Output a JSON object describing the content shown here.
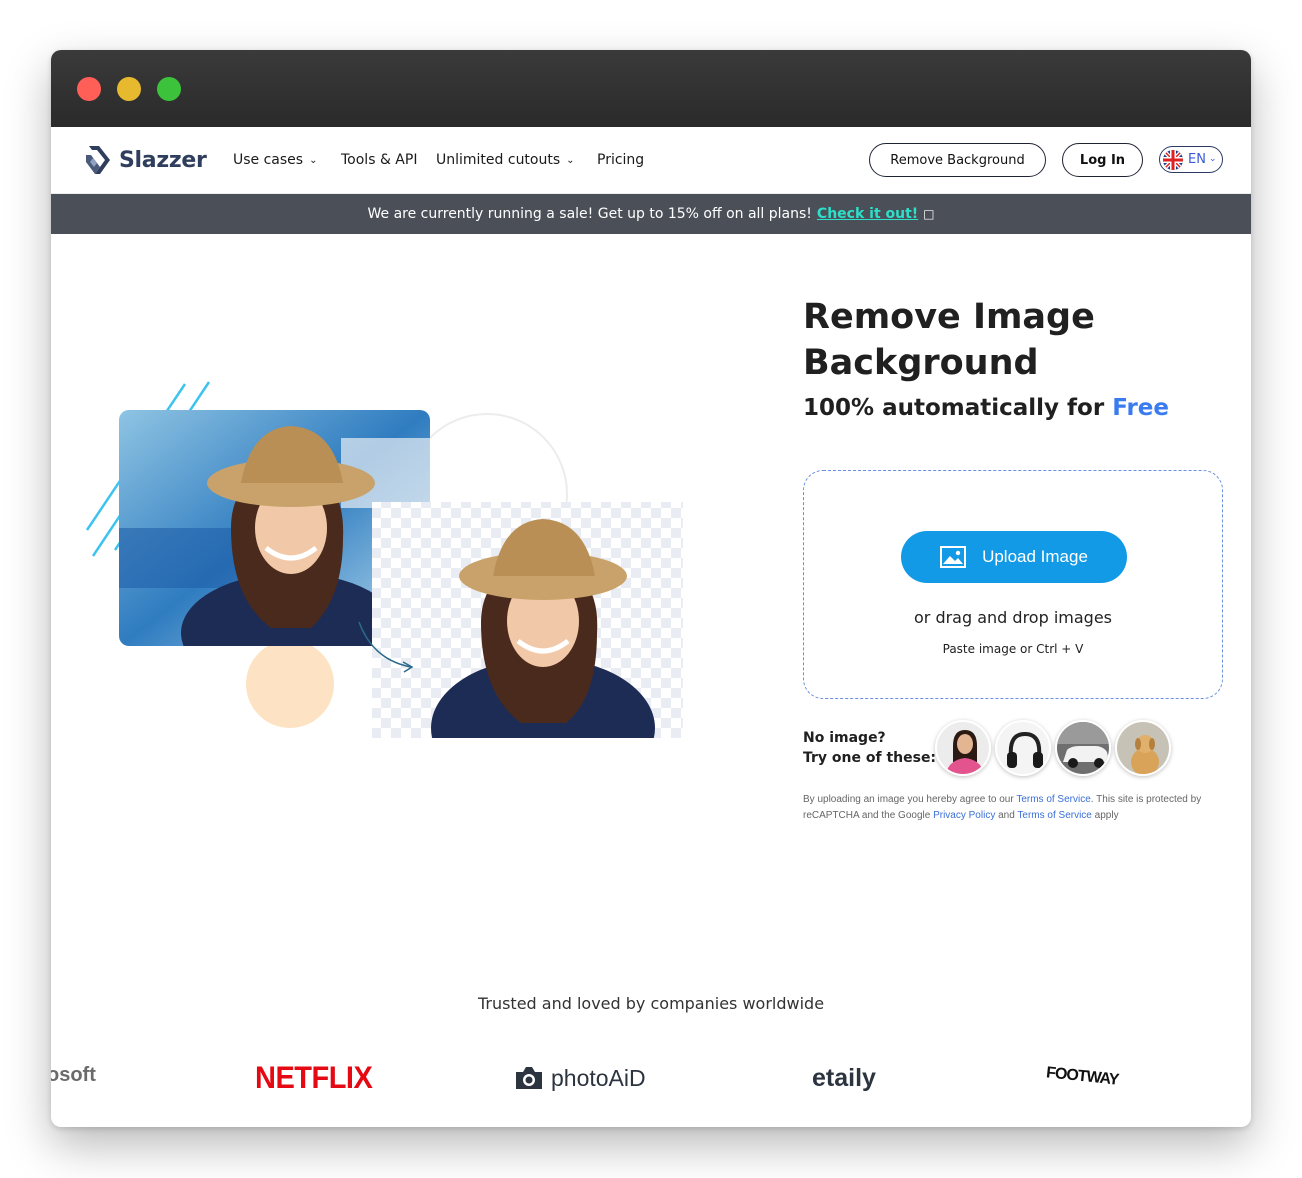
{
  "window": {
    "controls": [
      "close",
      "minimize",
      "zoom"
    ]
  },
  "nav": {
    "logo_text": "Slazzer",
    "items": [
      {
        "label": "Use cases",
        "has_dropdown": true
      },
      {
        "label": "Tools & API",
        "has_dropdown": false
      },
      {
        "label": "Unlimited cutouts",
        "has_dropdown": true
      },
      {
        "label": "Pricing",
        "has_dropdown": false
      }
    ],
    "remove_background_label": "Remove Background",
    "login_label": "Log In",
    "language": "EN"
  },
  "banner": {
    "text": "We are currently running a sale! Get up to 15% off on all plans!",
    "link_text": "Check it out!",
    "icon": "external-link-icon"
  },
  "hero": {
    "title": "Remove Image Background",
    "subtitle_prefix": "100% automatically for",
    "subtitle_highlight": "Free",
    "upload_label": "Upload Image",
    "drag_text": "or drag and drop images",
    "paste_text": "Paste image or Ctrl + V",
    "try_line1": "No image?",
    "try_line2": "Try one of these:",
    "samples": [
      "woman",
      "headphones",
      "car",
      "dog"
    ],
    "legal": {
      "part1": "By uploading an image you hereby agree to our",
      "terms1": "Terms of Service",
      "part2": ". This site is protected by reCAPTCHA and the Google",
      "privacy": "Privacy Policy",
      "part3": "and",
      "terms2": "Terms of Service",
      "part4": "apply"
    }
  },
  "trusted": {
    "heading": "Trusted and loved by companies worldwide",
    "logos": [
      "osoft",
      "NETFLIX",
      "photoAiD",
      "etaily",
      "FOOTWAY"
    ]
  },
  "colors": {
    "accent_blue": "#129ae6",
    "free_blue": "#3a7cf0",
    "banner_bg": "#4b4f58",
    "banner_link": "#2de0c9",
    "netflix_red": "#e50914"
  }
}
